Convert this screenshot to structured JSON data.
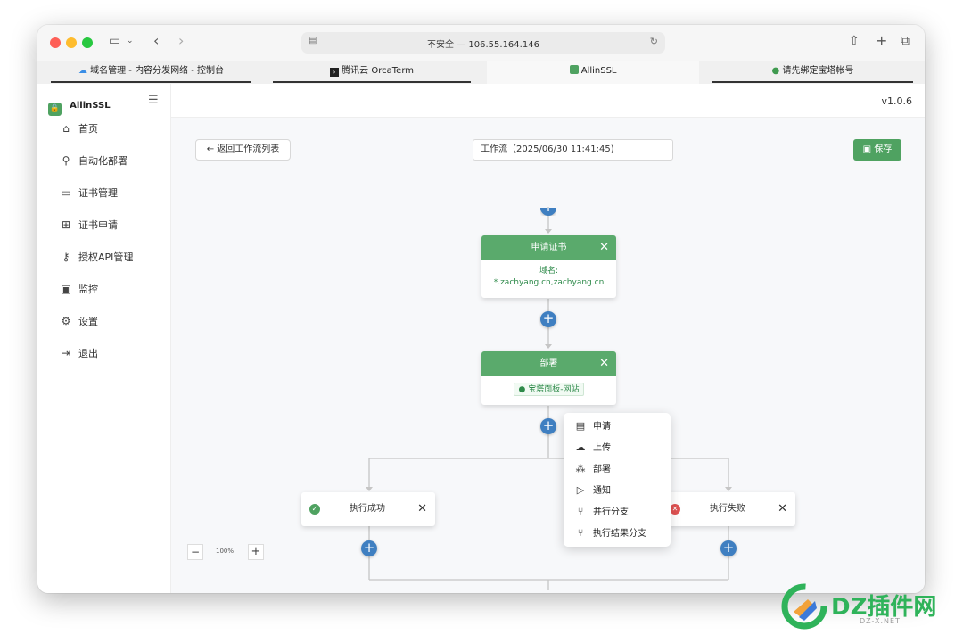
{
  "browser": {
    "address": "不安全 — 106.55.164.146",
    "tabs": [
      {
        "label": "域名管理 - 内容分发网络 - 控制台",
        "icon": "cloud-icon"
      },
      {
        "label": "腾讯云 OrcaTerm",
        "icon": "terminal-icon"
      },
      {
        "label": "AllinSSL",
        "icon": "lock-icon"
      },
      {
        "label": "请先绑定宝塔帐号",
        "icon": "bt-panel-icon"
      }
    ]
  },
  "app": {
    "name": "AllinSSL",
    "version": "v1.0.6",
    "brand_color": "#4fa261"
  },
  "sidebar": {
    "items": [
      {
        "label": "首页",
        "icon": "home-icon"
      },
      {
        "label": "自动化部署",
        "icon": "workflow-icon"
      },
      {
        "label": "证书管理",
        "icon": "certificate-icon"
      },
      {
        "label": "证书申请",
        "icon": "plus-square-icon"
      },
      {
        "label": "授权API管理",
        "icon": "api-key-icon"
      },
      {
        "label": "监控",
        "icon": "monitor-icon"
      },
      {
        "label": "设置",
        "icon": "settings-icon"
      },
      {
        "label": "退出",
        "icon": "logout-icon"
      }
    ]
  },
  "toolbar": {
    "back_label": "← 返回工作流列表",
    "workflow_title": "工作流（2025/06/30 11:41:45)",
    "save_label": "保存"
  },
  "workflow": {
    "apply_node": {
      "title": "申请证书",
      "field_label": "域名:",
      "field_value": "*.zachyang.cn,zachyang.cn"
    },
    "deploy_node": {
      "title": "部署",
      "tag": "宝塔面板-网站"
    },
    "success_branch": {
      "label": "执行成功"
    },
    "fail_branch": {
      "label": "执行失败"
    }
  },
  "context_menu": {
    "items": [
      {
        "label": "申请",
        "icon": "apply-icon"
      },
      {
        "label": "上传",
        "icon": "upload-icon"
      },
      {
        "label": "部署",
        "icon": "deploy-icon"
      },
      {
        "label": "通知",
        "icon": "notify-icon"
      },
      {
        "label": "并行分支",
        "icon": "parallel-branch-icon"
      },
      {
        "label": "执行结果分支",
        "icon": "result-branch-icon"
      }
    ]
  },
  "zoom": {
    "level": "100%"
  },
  "watermark": {
    "text": "DZ插件网",
    "sub": "DZ-X.NET"
  }
}
